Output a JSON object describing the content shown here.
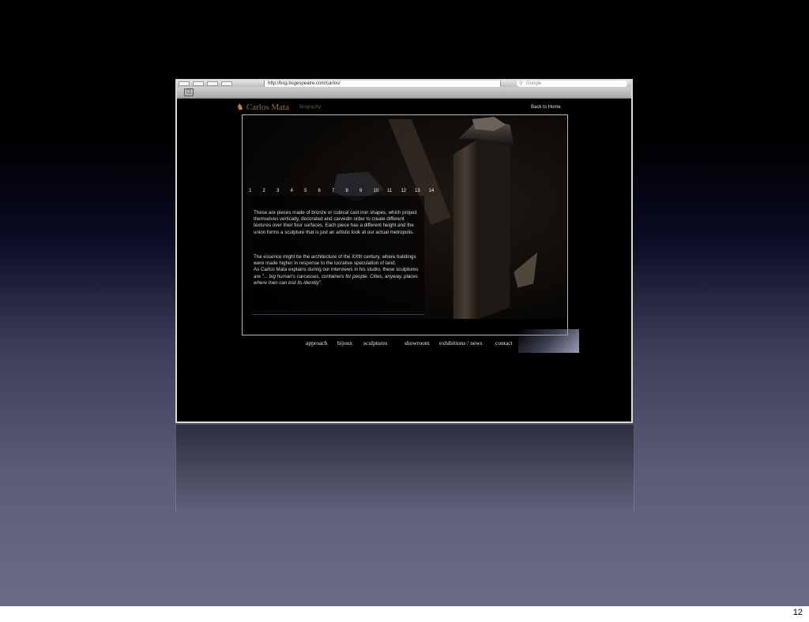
{
  "slide": {
    "page_number": "12"
  },
  "browser": {
    "url": "http://bsg.bsgespeatre.com/carlos/",
    "search_placeholder": "Google",
    "bookmark_icon": "open-book-icon"
  },
  "site": {
    "logo_text": "Carlos Mata",
    "logo_icon": "horse-icon",
    "subtitle": "Biography",
    "back_link": "Back to Home",
    "image_numbers": [
      "1",
      "2",
      "3",
      "4",
      "5",
      "6",
      "7",
      "8",
      "9",
      "10",
      "11",
      "12",
      "13",
      "14"
    ],
    "paragraph1": "These are pieces made of bronze or cubical cast iron shapes, which project themselves vertically, decorated and carvedin order  to create different textures over their four surfaces. Each piece has a different height and the union forms a sculpture that is just an artistic look at our actual metropolis.",
    "paragraph2_line1": "The essence might be the architecture of the XXth century, where buildings were made higher in response to the lucrative speculation of land.",
    "paragraph2_line2": "As Carlos Mata explains during our interviews in his studio, these sculptures are ",
    "paragraph2_quote": "\"... big human's carcasses, containers for people. Cities, anyway, places where men can lost its identity\".",
    "nav": [
      "approach",
      "bijoux",
      "sculptures",
      "showroom",
      "exhibitions / news",
      "contact"
    ]
  },
  "colors": {
    "logo": "#9a6f33",
    "background": "#000000",
    "slide_bottom": "#6b6c84"
  }
}
